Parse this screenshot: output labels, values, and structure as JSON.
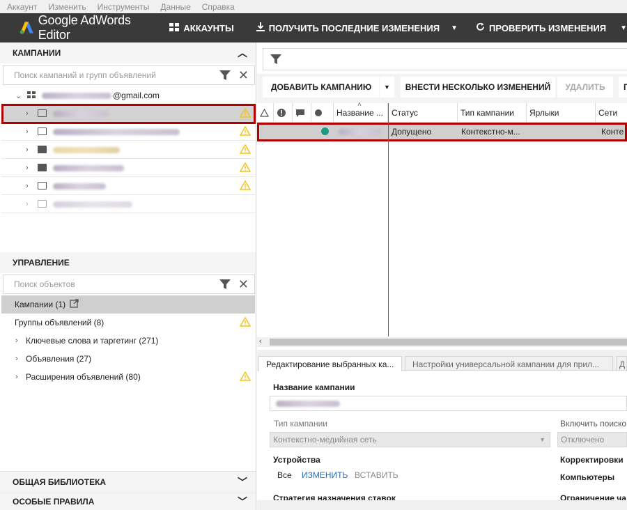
{
  "menu": [
    "Аккаунт",
    "Изменить",
    "Инструменты",
    "Данные",
    "Справка"
  ],
  "app": {
    "title": "Google AdWords Editor",
    "accounts_label": "АККАУНТЫ",
    "get_changes_label": "ПОЛУЧИТЬ ПОСЛЕДНИЕ ИЗМЕНЕНИЯ",
    "check_changes_label": "ПРОВЕРИТЬ ИЗМЕНЕНИЯ"
  },
  "campaigns_panel": {
    "title": "КАМПАНИИ",
    "search_placeholder": "Поиск кампаний и групп объявлений",
    "account_suffix": "@gmail.com"
  },
  "management": {
    "title": "УПРАВЛЕНИЕ",
    "search_placeholder": "Поиск объектов",
    "items": [
      "Кампании (1)",
      "Группы объявлений (8)",
      "Ключевые слова и таргетинг (271)",
      "Объявления (27)",
      "Расширения объявлений (80)"
    ]
  },
  "library_title": "ОБЩАЯ БИБЛИОТЕКА",
  "rules_title": "ОСОБЫЕ ПРАВИЛА",
  "toolbar": {
    "add_campaign": "ДОБАВИТЬ КАМПАНИЮ",
    "bulk_changes": "ВНЕСТИ НЕСКОЛЬКО ИЗМЕНЕНИЙ",
    "delete": "УДАЛИТЬ"
  },
  "grid": {
    "columns": [
      "Название ...",
      "Статус",
      "Тип кампании",
      "Ярлыки",
      "Сети"
    ],
    "row": {
      "status": "Допущено",
      "type": "Контекстно-м...",
      "networks": "Конте"
    }
  },
  "tabs": [
    "Редактирование выбранных ка...",
    "Настройки универсальной кампании для прил...",
    "Д"
  ],
  "edit": {
    "campaign_name_label": "Название кампании",
    "campaign_type_label": "Тип кампании",
    "campaign_type_value": "Контекстно-медийная сеть",
    "search_partners_label": "Включить поиско",
    "search_partners_value": "Отключено",
    "devices_label": "Устройства",
    "devices_value": "Все",
    "change_link": "ИЗМЕНИТЬ",
    "paste_link": "ВСТАВИТЬ",
    "adjustments_label": "Корректировки",
    "computers_label": "Компьютеры",
    "bid_strategy_label": "Стратегия назначения ставок",
    "limit_label": "Ограничение ча"
  },
  "colors": {
    "topbar": "#3a3a3a",
    "highlight_border": "#b30000",
    "status_dot": "#1a9a80",
    "link": "#2a6fb8",
    "warning": "#f2c21b"
  }
}
